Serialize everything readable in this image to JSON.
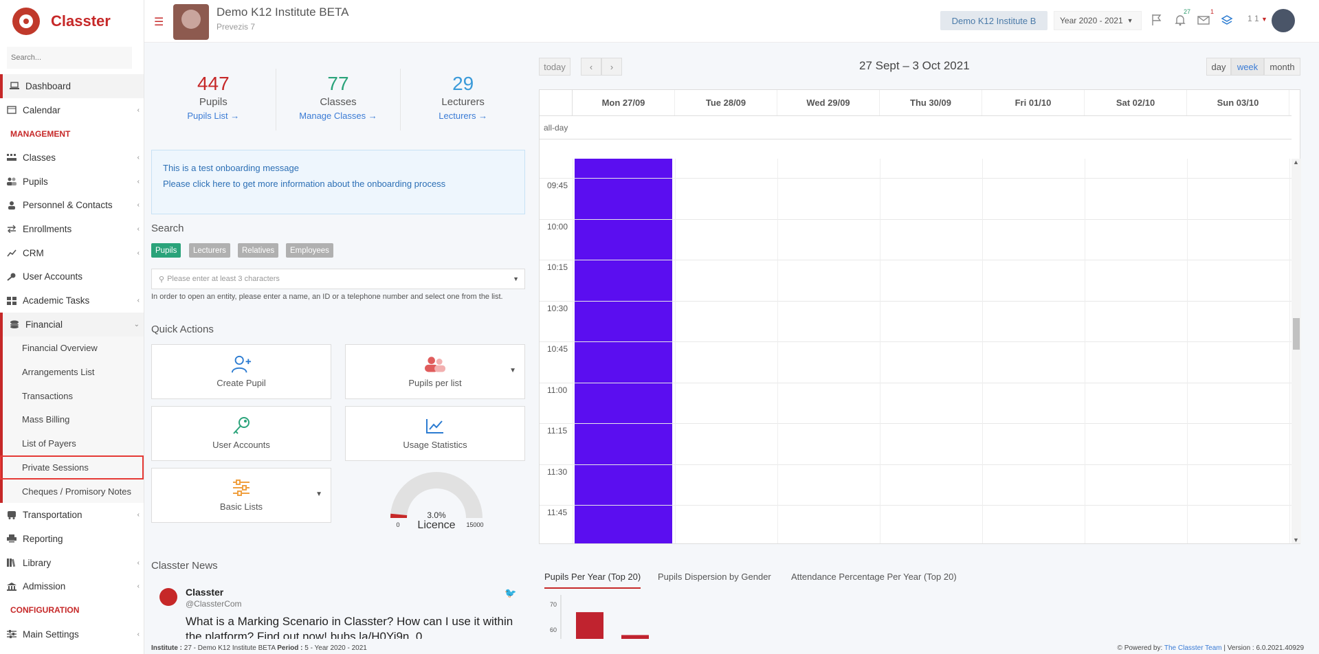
{
  "app": {
    "name": "Classter"
  },
  "sidebar": {
    "search_placeholder": "Search...",
    "items": [
      {
        "label": "Dashboard"
      },
      {
        "label": "Calendar"
      },
      {
        "section": "MANAGEMENT"
      },
      {
        "label": "Classes"
      },
      {
        "label": "Pupils"
      },
      {
        "label": "Personnel & Contacts"
      },
      {
        "label": "Enrollments"
      },
      {
        "label": "CRM"
      },
      {
        "label": "User Accounts"
      },
      {
        "label": "Academic Tasks"
      },
      {
        "label": "Financial"
      }
    ],
    "financial_sub": [
      "Financial Overview",
      "Arrangements List",
      "Transactions",
      "Mass Billing",
      "List of Payers",
      "Private Sessions",
      "Cheques / Promisory Notes"
    ],
    "after": [
      {
        "label": "Transportation"
      },
      {
        "label": "Reporting"
      },
      {
        "label": "Library"
      },
      {
        "label": "Admission"
      }
    ],
    "config_section": "CONFIGURATION",
    "main_settings": "Main Settings"
  },
  "header": {
    "institute": "Demo K12 Institute BETA",
    "subtitle": "Prevezis 7",
    "institute_btn": "Demo K12 Institute B",
    "year": "Year 2020 - 2021",
    "notif_count": "27",
    "mail_count": "1",
    "user": "1 1"
  },
  "stats": [
    {
      "num": "447",
      "label": "Pupils",
      "link": "Pupils List  →",
      "color": "#c62828"
    },
    {
      "num": "77",
      "label": "Classes",
      "link": "Manage Classes  →",
      "color": "#2aa37a"
    },
    {
      "num": "29",
      "label": "Lecturers",
      "link": "Lecturers  →",
      "color": "#3a9ad9"
    }
  ],
  "onboarding": {
    "line1": "This is a test onboarding message",
    "line2": "Please click here to get more information about the onboarding process"
  },
  "search": {
    "title": "Search",
    "tabs": [
      "Pupils",
      "Lecturers",
      "Relatives",
      "Employees"
    ],
    "placeholder": "Please enter at least 3 characters",
    "hint": "In order to open an entity, please enter a name, an ID or a telephone number and select one from the list."
  },
  "quick_actions": {
    "title": "Quick Actions",
    "items": [
      "Create Pupil",
      "Pupils per list",
      "User Accounts",
      "Usage Statistics",
      "Basic Lists"
    ]
  },
  "licence": {
    "percent": "3.0%",
    "label": "Licence",
    "min": "0",
    "max": "15000",
    "fill_fraction": 0.03
  },
  "news": {
    "title": "Classter News",
    "account": "Classter",
    "handle": "@ClassterCom",
    "text": "What is a Marking Scenario in Classter? How can I use it within the platform? Find out now! bubs.la/H0Yi9n_0"
  },
  "calendar": {
    "today": "today",
    "prev": "‹",
    "next": "›",
    "range": "27 Sept – 3 Oct 2021",
    "views": [
      "day",
      "week",
      "month"
    ],
    "active_view": "week",
    "days": [
      "Mon 27/09",
      "Tue 28/09",
      "Wed 29/09",
      "Thu 30/09",
      "Fri 01/10",
      "Sat 02/10",
      "Sun 03/10"
    ],
    "allday": "all-day",
    "times": [
      "09:45",
      "10:00",
      "10:15",
      "10:30",
      "10:45",
      "11:00",
      "11:15",
      "11:30",
      "11:45"
    ],
    "event_color": "#5b0ef0"
  },
  "chart_tabs": [
    "Pupils Per Year (Top 20)",
    "Pupils Dispersion by Gender",
    "Attendance Percentage Per Year (Top 20)"
  ],
  "chart_data": {
    "type": "bar",
    "y_ticks": [
      "70",
      "60"
    ],
    "values": [
      67,
      58
    ],
    "colors": [
      "#c0232f"
    ]
  },
  "footer": {
    "institute_label": "Institute :",
    "institute": "27 - Demo K12 Institute BETA",
    "period_label": "Period :",
    "period": "5 - Year 2020 - 2021",
    "powered": "Powered by:",
    "team": "The Classter Team",
    "version": "| Version : 6.0.2021.40929"
  }
}
